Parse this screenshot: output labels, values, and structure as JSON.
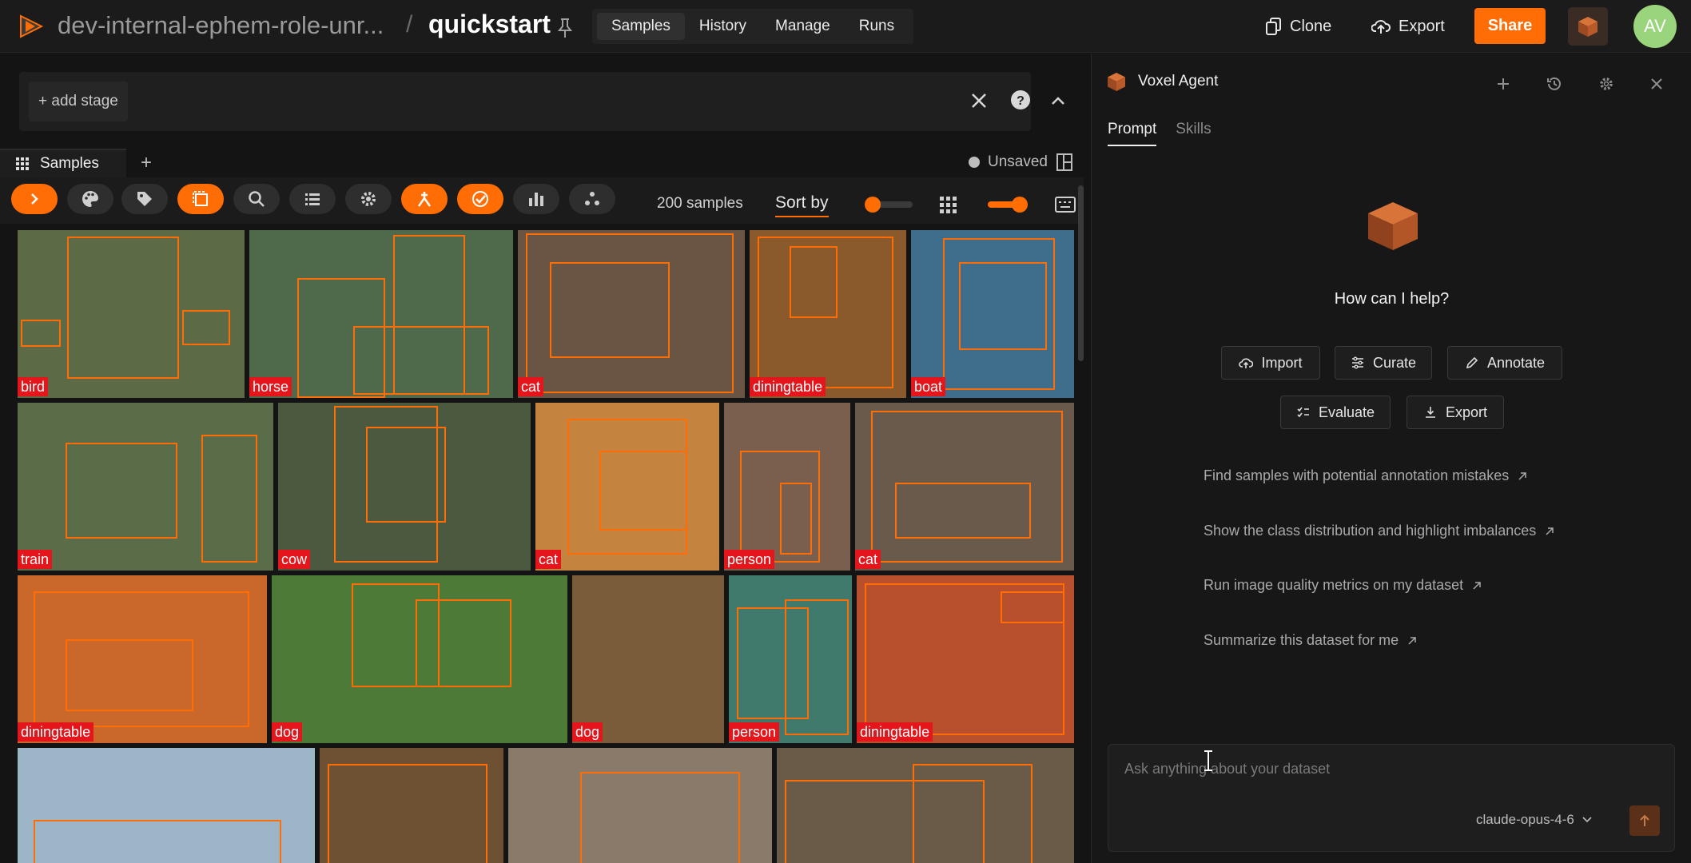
{
  "topbar": {
    "dataset_name": "dev-internal-ephem-role-unr...",
    "separator": "/",
    "view_name": "quickstart",
    "tabs": [
      {
        "label": "Samples",
        "active": true
      },
      {
        "label": "History",
        "active": false
      },
      {
        "label": "Manage",
        "active": false
      },
      {
        "label": "Runs",
        "active": false
      }
    ],
    "clone_label": "Clone",
    "export_label": "Export",
    "share_label": "Share",
    "avatar_initials": "AV",
    "accent_color": "#ff6d04"
  },
  "stagebar": {
    "add_stage_label": "+ add stage"
  },
  "samples_panel": {
    "tab_label": "Samples",
    "add_tab_label": "+",
    "status_label": "Unsaved",
    "sample_count": "200 samples",
    "sort_label": "Sort by",
    "toolbar_icons": [
      {
        "name": "sidebar-toggle-icon",
        "active": true
      },
      {
        "name": "color-palette-icon",
        "active": false
      },
      {
        "name": "tag-icon",
        "active": false
      },
      {
        "name": "select-icon",
        "active": true
      },
      {
        "name": "search-icon",
        "active": false
      },
      {
        "name": "list-icon",
        "active": false
      },
      {
        "name": "settings-icon",
        "active": false
      },
      {
        "name": "patches-icon",
        "active": true
      },
      {
        "name": "checkmark-icon",
        "active": true
      },
      {
        "name": "histogram-icon",
        "active": false
      },
      {
        "name": "embeddings-icon",
        "active": false
      }
    ]
  },
  "grid": {
    "rows": [
      [
        {
          "label": "bird",
          "color": "#5c6a45"
        },
        {
          "label": "horse",
          "color": "#4f6a4a"
        },
        {
          "label": "cat",
          "color": "#6a5444"
        },
        {
          "label": "diningtable",
          "color": "#8a5a2c"
        },
        {
          "label": "boat",
          "color": "#3e6e8c"
        }
      ],
      [
        {
          "label": "train",
          "color": "#5a6c48"
        },
        {
          "label": "cow",
          "color": "#4b5a3e"
        },
        {
          "label": "cat",
          "color": "#c48440"
        },
        {
          "label": "person",
          "color": "#7a5e4e"
        },
        {
          "label": "cat",
          "color": "#6a5a4c"
        }
      ],
      [
        {
          "label": "diningtable",
          "color": "#c9682a"
        },
        {
          "label": "dog",
          "color": "#4d7a36"
        },
        {
          "label": "dog",
          "color": "#7a5c3a"
        },
        {
          "label": "person",
          "color": "#3f7a6c"
        },
        {
          "label": "diningtable",
          "color": "#b8502e"
        }
      ],
      [
        {
          "label": "",
          "color": "#9cb6c8"
        },
        {
          "label": "",
          "color": "#6e5032"
        },
        {
          "label": "",
          "color": "#8a7a6a"
        },
        {
          "label": "",
          "color": "#6a5a48"
        }
      ]
    ]
  },
  "agent": {
    "title": "Voxel Agent",
    "tabs": [
      {
        "label": "Prompt",
        "active": true
      },
      {
        "label": "Skills",
        "active": false
      }
    ],
    "greeting": "How can I help?",
    "actions": [
      "Import",
      "Curate",
      "Annotate",
      "Evaluate",
      "Export"
    ],
    "suggestions": [
      "Find samples with potential annotation mistakes",
      "Show the class distribution and highlight imbalances",
      "Run image quality metrics on my dataset",
      "Summarize this dataset for me"
    ],
    "input_placeholder": "Ask anything about your dataset",
    "model": "claude-opus-4-6"
  }
}
